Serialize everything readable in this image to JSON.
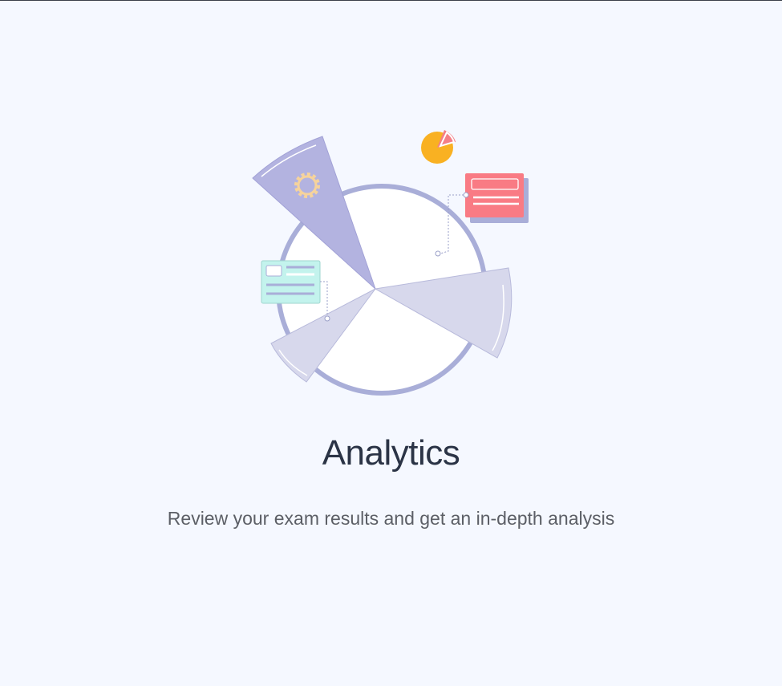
{
  "onboarding": {
    "title": "Analytics",
    "subtitle": "Review your exam results and get an in-depth analysis"
  },
  "illustration": {
    "icons": [
      "pie-chart-icon",
      "gear-icon",
      "card-icon"
    ],
    "colors": {
      "ring": "#a9aed8",
      "slice_dark": "#b3b3e0",
      "slice_light": "#d7d8ec",
      "gear": "#f6d39c",
      "pie": "#f9b122",
      "pie_cut": "#f47f86",
      "card_red": "#f97b84",
      "card_teal": "#c3f3ed"
    }
  }
}
